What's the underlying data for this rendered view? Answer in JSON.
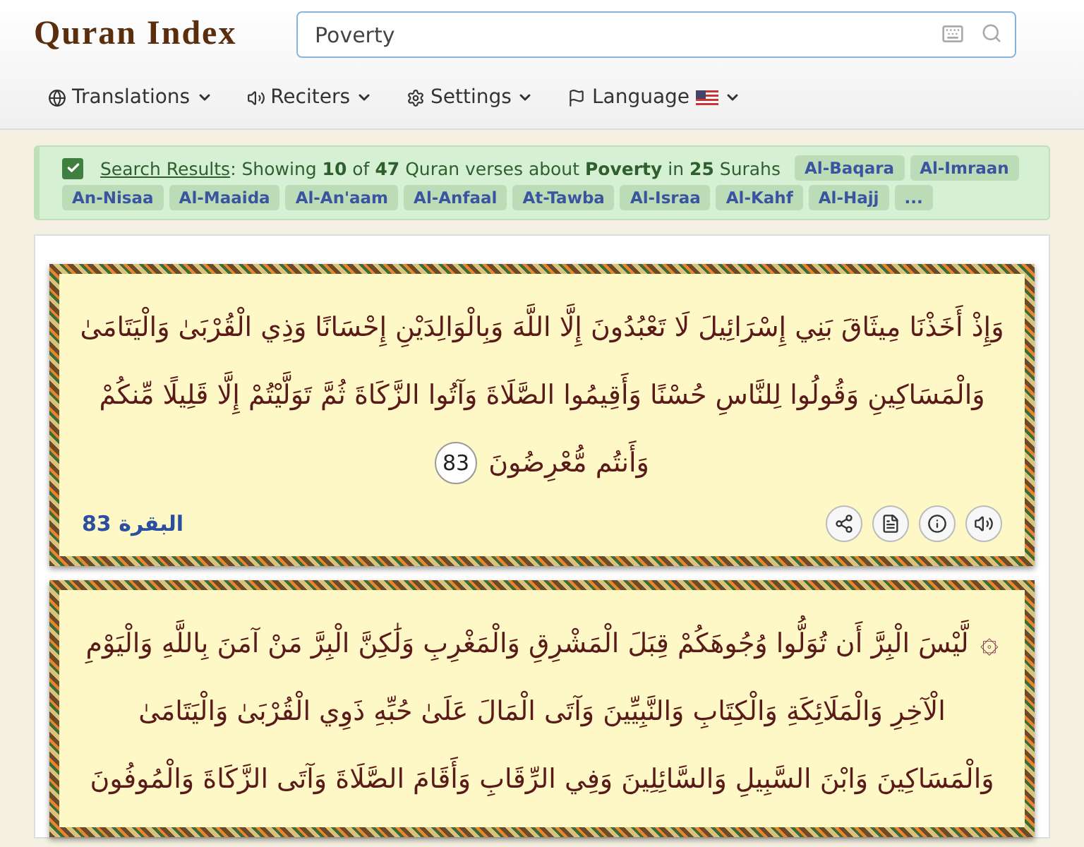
{
  "header": {
    "logo": "Quran Index",
    "search": {
      "value": "Poverty"
    }
  },
  "nav": [
    {
      "label": "Translations",
      "kind": "globe"
    },
    {
      "label": "Reciters",
      "kind": "speaker"
    },
    {
      "label": "Settings",
      "kind": "gear"
    },
    {
      "label": "Language",
      "kind": "flag"
    }
  ],
  "results": {
    "checked": true,
    "link": "Search Results",
    "summary": ": Showing **10** of **47** Quran verses about **Poverty** in **25** Surahs",
    "surahs": [
      "Al-Baqara",
      "Al-Imraan",
      "An-Nisaa",
      "Al-Maaida",
      "Al-An'aam",
      "Al-Anfaal",
      "At-Tawba",
      "Al-Israa",
      "Al-Kahf",
      "Al-Hajj",
      "..."
    ]
  },
  "verses": [
    {
      "lines": [
        "وَإِذْ أَخَذْنَا مِيثَاقَ بَنِي إِسْرَائِيلَ لَا تَعْبُدُونَ إِلَّا اللَّهَ وَبِالْوَالِدَيْنِ إِحْسَانًا وَذِي الْقُرْبَىٰ وَالْيَتَامَىٰ",
        "وَالْمَسَاكِينِ وَقُولُوا لِلنَّاسِ حُسْنًا وَأَقِيمُوا الصَّلَاةَ وَآتُوا الزَّكَاةَ ثُمَّ تَوَلَّيْتُمْ إِلَّا قَلِيلًا مِّنكُمْ",
        "وَأَنتُم مُّعْرِضُونَ"
      ],
      "number": "83",
      "reference": "البقرة 83"
    },
    {
      "mark": "۞",
      "lines": [
        "لَّيْسَ الْبِرَّ أَن تُوَلُّوا وُجُوهَكُمْ قِبَلَ الْمَشْرِقِ وَالْمَغْرِبِ وَلَٰكِنَّ الْبِرَّ مَنْ آمَنَ بِاللَّهِ وَالْيَوْمِ",
        "الْآخِرِ وَالْمَلَائِكَةِ وَالْكِتَابِ وَالنَّبِيِّينَ وَآتَى الْمَالَ عَلَىٰ حُبِّهِ ذَوِي الْقُرْبَىٰ وَالْيَتَامَىٰ",
        "وَالْمَسَاكِينَ وَابْنَ السَّبِيلِ وَالسَّائِلِينَ وَفِي الرِّقَابِ وَأَقَامَ الصَّلَاةَ وَآتَى الزَّكَاةَ وَالْمُوفُونَ"
      ]
    }
  ]
}
